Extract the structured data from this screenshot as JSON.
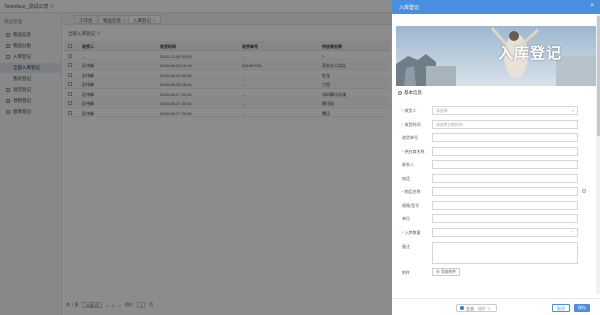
{
  "topbar": {
    "company": "Teamface_测试公司 ∨"
  },
  "sidebar": {
    "section_title": "物品管理",
    "items": [
      {
        "label": "物品信息",
        "sub": false,
        "active": false,
        "more": ""
      },
      {
        "label": "物品分类",
        "sub": false,
        "active": false,
        "more": ""
      },
      {
        "label": "入库登记",
        "sub": false,
        "active": false,
        "more": "···"
      },
      {
        "label": "全部入库登记",
        "sub": true,
        "active": true,
        "more": ""
      },
      {
        "label": "我的登记",
        "sub": true,
        "active": false,
        "more": ""
      },
      {
        "label": "退货登记",
        "sub": false,
        "active": false,
        "more": ""
      },
      {
        "label": "领物登记",
        "sub": false,
        "active": false,
        "more": ""
      },
      {
        "label": "盘库登记",
        "sub": false,
        "active": false,
        "more": ""
      }
    ]
  },
  "tabs": [
    {
      "label": "工作台",
      "close": ""
    },
    {
      "label": "物品信息",
      "close": "×"
    },
    {
      "label": "入库登记",
      "close": "×"
    }
  ],
  "main": {
    "breadcrumb": "全部入库登记 ∨",
    "columns": [
      "收货人",
      "收货时间",
      "收货单号",
      "供应商名称"
    ],
    "rows": [
      [
        "--",
        "2018-12-06 00:00",
        "--",
        "1"
      ],
      [
        "彭伟峰",
        "2018-08-29 10:19",
        "201807001",
        "直发办公用品"
      ],
      [
        "彭伟峰",
        "2018-08-29 09:46",
        "--",
        "秋龙"
      ],
      [
        "彭伟峰",
        "2018-08-28 18:44",
        "--",
        "工程"
      ],
      [
        "彭伟峰",
        "2018-08-27 20:34",
        "--",
        "深圳腾讯动漫"
      ],
      [
        "彭伟峰",
        "2018-08-27 20:32",
        "--",
        "腾讯电"
      ],
      [
        "彭伟峰",
        "2018-08-27 20:30",
        "--",
        "腾迅"
      ]
    ],
    "pager": {
      "total": "共 7 条",
      "page_size": "20条/页",
      "prev": "<",
      "page": "1",
      "next": ">",
      "goto_label": "前往",
      "goto_value": "1",
      "goto_suffix": "页"
    }
  },
  "drawer": {
    "title": "入库登记",
    "close_icon": "close-icon",
    "banner_title": "入库登记",
    "section_title": "基本信息",
    "fields": [
      {
        "label": "收货人",
        "required": true,
        "placeholder": "请选择",
        "kind": "select"
      },
      {
        "label": "收货时间",
        "required": true,
        "placeholder": "请选择日期时间",
        "kind": "date"
      },
      {
        "label": "收货单号",
        "required": false,
        "placeholder": "",
        "kind": "text"
      },
      {
        "label": "供应商名称",
        "required": true,
        "placeholder": "",
        "kind": "text"
      },
      {
        "label": "联系人",
        "required": false,
        "placeholder": "",
        "kind": "text"
      },
      {
        "label": "电话",
        "required": false,
        "placeholder": "",
        "kind": "text"
      },
      {
        "label": "物品名称",
        "required": true,
        "placeholder": "",
        "kind": "lookup"
      },
      {
        "label": "规格/型号",
        "required": false,
        "placeholder": "",
        "kind": "text"
      },
      {
        "label": "单位",
        "required": false,
        "placeholder": "",
        "kind": "text"
      },
      {
        "label": "入库数量",
        "required": true,
        "placeholder": "",
        "kind": "number"
      }
    ],
    "remark_label": "备注",
    "attachment_label": "附件",
    "upload_label": "⊕ 添加附件",
    "footer": {
      "switch_label": "企业",
      "switch_option": "插件 ∨",
      "cancel": "取消",
      "save": "保存"
    }
  },
  "colors": {
    "accent": "#4a8ee0",
    "overlay": "rgba(0,0,0,0.45)"
  }
}
